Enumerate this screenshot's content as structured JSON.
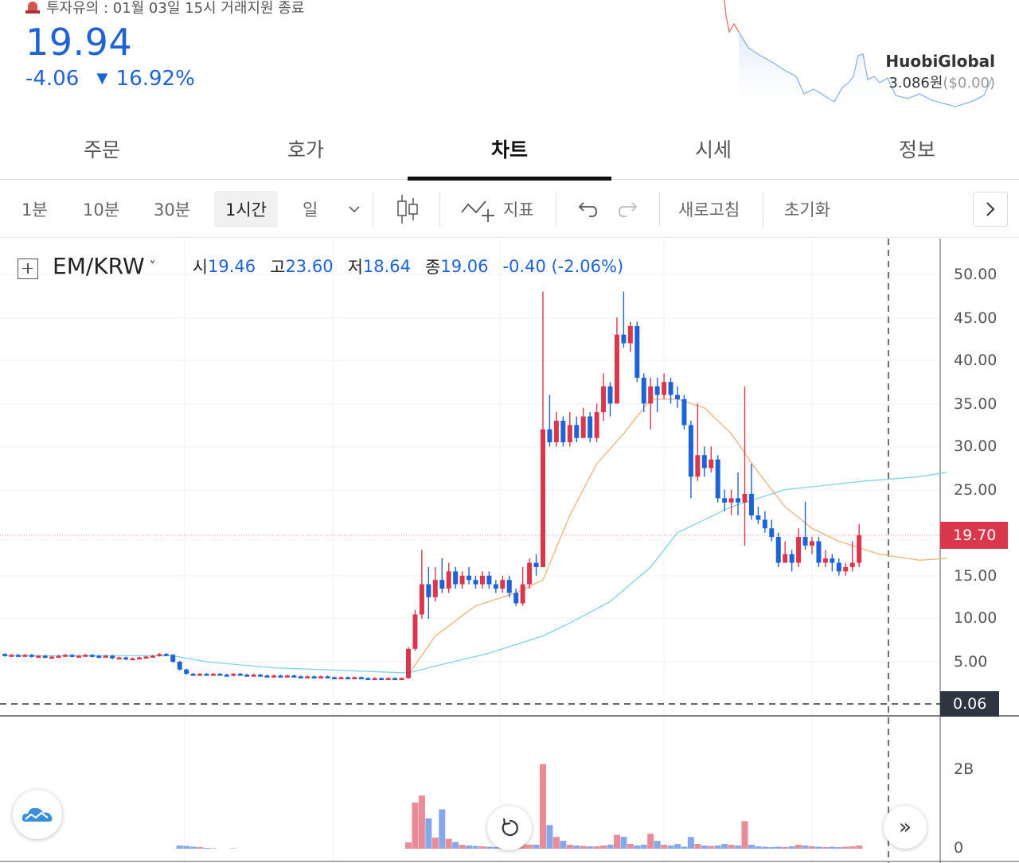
{
  "header": {
    "warning": "투자유의 : 01월 03일 15시 거래지원 종료",
    "price": "19.94",
    "change": "-4.06",
    "change_pct": "16.92%",
    "exchange_name": "HuobiGlobal",
    "exchange_price": "3.086원",
    "exchange_usd": "($0.00)"
  },
  "tabs": [
    "주문",
    "호가",
    "차트",
    "시세",
    "정보"
  ],
  "active_tab": "차트",
  "toolbar": {
    "intervals": [
      "1분",
      "10분",
      "30분",
      "1시간",
      "일"
    ],
    "selected_interval": "1시간",
    "indicator_label": "지표",
    "refresh_label": "새로고침",
    "reset_label": "초기화"
  },
  "legend": {
    "symbol": "EM/KRW",
    "open_label": "시",
    "open": "19.46",
    "high_label": "고",
    "high": "23.60",
    "low_label": "저",
    "low": "18.64",
    "close_label": "종",
    "close": "19.06",
    "change": "-0.40 (-2.06%)"
  },
  "colors": {
    "up": "#d9374b",
    "down": "#1e63d6",
    "ma_short": "#f3b27a",
    "ma_long": "#7fd3e6"
  },
  "chart_data": {
    "type": "candlestick",
    "price_axis_ticks": [
      "50.00",
      "45.00",
      "40.00",
      "35.00",
      "30.00",
      "25.00",
      "15.00",
      "10.00",
      "5.00"
    ],
    "current_price_label": "19.70",
    "low_price_label": "0.06",
    "volume_axis_ticks": [
      "2B",
      "0"
    ],
    "ylim": [
      0,
      52
    ],
    "candles": [
      [
        5.9,
        5.7,
        6.0,
        5.6
      ],
      [
        5.7,
        5.8,
        5.9,
        5.6
      ],
      [
        5.8,
        5.7,
        5.9,
        5.6
      ],
      [
        5.7,
        5.8,
        5.9,
        5.6
      ],
      [
        5.8,
        5.6,
        5.9,
        5.5
      ],
      [
        5.6,
        5.7,
        5.8,
        5.5
      ],
      [
        5.7,
        5.5,
        5.8,
        5.4
      ],
      [
        5.5,
        5.6,
        5.7,
        5.4
      ],
      [
        5.6,
        5.7,
        5.8,
        5.5
      ],
      [
        5.7,
        5.8,
        5.9,
        5.6
      ],
      [
        5.8,
        5.6,
        5.9,
        5.5
      ],
      [
        5.6,
        5.7,
        5.8,
        5.5
      ],
      [
        5.7,
        5.8,
        5.9,
        5.6
      ],
      [
        5.8,
        5.7,
        5.9,
        5.5
      ],
      [
        5.7,
        5.6,
        5.8,
        5.4
      ],
      [
        5.6,
        5.7,
        5.8,
        5.5
      ],
      [
        5.7,
        5.4,
        5.8,
        5.3
      ],
      [
        5.4,
        5.5,
        5.6,
        5.3
      ],
      [
        5.5,
        5.3,
        5.6,
        5.2
      ],
      [
        5.3,
        5.4,
        5.5,
        5.2
      ],
      [
        5.4,
        5.5,
        5.6,
        5.3
      ],
      [
        5.5,
        5.6,
        5.7,
        5.4
      ],
      [
        5.6,
        5.7,
        5.8,
        5.5
      ],
      [
        5.7,
        5.9,
        6.0,
        5.6
      ],
      [
        5.9,
        5.8,
        6.0,
        5.7
      ],
      [
        5.8,
        5.0,
        5.9,
        4.9
      ],
      [
        5.0,
        4.1,
        5.1,
        4.0
      ],
      [
        4.1,
        3.6,
        4.2,
        3.5
      ],
      [
        3.6,
        3.5,
        3.7,
        3.4
      ],
      [
        3.5,
        3.6,
        3.7,
        3.4
      ],
      [
        3.6,
        3.5,
        3.7,
        3.4
      ],
      [
        3.5,
        3.6,
        3.7,
        3.4
      ],
      [
        3.6,
        3.5,
        3.7,
        3.4
      ],
      [
        3.5,
        3.4,
        3.6,
        3.3
      ],
      [
        3.4,
        3.6,
        3.7,
        3.3
      ],
      [
        3.6,
        3.5,
        3.7,
        3.4
      ],
      [
        3.5,
        3.4,
        3.6,
        3.3
      ],
      [
        3.4,
        3.5,
        3.6,
        3.3
      ],
      [
        3.5,
        3.4,
        3.6,
        3.3
      ],
      [
        3.4,
        3.3,
        3.5,
        3.2
      ],
      [
        3.3,
        3.4,
        3.5,
        3.2
      ],
      [
        3.4,
        3.3,
        3.5,
        3.2
      ],
      [
        3.3,
        3.4,
        3.5,
        3.2
      ],
      [
        3.4,
        3.3,
        3.5,
        3.2
      ],
      [
        3.3,
        3.2,
        3.4,
        3.1
      ],
      [
        3.2,
        3.3,
        3.4,
        3.1
      ],
      [
        3.3,
        3.2,
        3.4,
        3.1
      ],
      [
        3.2,
        3.3,
        3.4,
        3.1
      ],
      [
        3.3,
        3.2,
        3.4,
        3.1
      ],
      [
        3.2,
        3.1,
        3.3,
        3.0
      ],
      [
        3.1,
        3.2,
        3.3,
        3.0
      ],
      [
        3.2,
        3.1,
        3.3,
        3.0
      ],
      [
        3.1,
        3.2,
        3.3,
        3.0
      ],
      [
        3.2,
        3.1,
        3.3,
        3.0
      ],
      [
        3.1,
        3.0,
        3.2,
        2.9
      ],
      [
        3.0,
        3.1,
        3.2,
        2.9
      ],
      [
        3.1,
        3.0,
        3.2,
        2.9
      ],
      [
        3.0,
        3.1,
        3.2,
        2.9
      ],
      [
        3.1,
        3.0,
        3.2,
        2.9
      ],
      [
        3.0,
        3.1,
        3.2,
        2.9
      ],
      [
        3.1,
        6.5,
        6.7,
        3.0
      ],
      [
        6.5,
        10.5,
        11.0,
        6.3
      ],
      [
        10.5,
        14.0,
        18.0,
        10.0
      ],
      [
        14.0,
        12.5,
        16.0,
        10.0
      ],
      [
        12.5,
        14.5,
        16.0,
        12.0
      ],
      [
        14.5,
        13.5,
        17.0,
        13.0
      ],
      [
        13.5,
        15.5,
        16.5,
        13.0
      ],
      [
        15.5,
        14.0,
        16.0,
        13.5
      ],
      [
        14.0,
        15.0,
        15.5,
        13.5
      ],
      [
        15.0,
        14.5,
        16.0,
        14.0
      ],
      [
        14.5,
        14.0,
        15.0,
        13.5
      ],
      [
        14.0,
        15.0,
        15.5,
        13.5
      ],
      [
        15.0,
        14.0,
        15.5,
        13.5
      ],
      [
        14.0,
        13.5,
        14.5,
        13.0
      ],
      [
        13.5,
        14.5,
        15.0,
        13.0
      ],
      [
        14.5,
        13.0,
        15.0,
        12.5
      ],
      [
        13.0,
        11.8,
        13.5,
        11.5
      ],
      [
        11.8,
        14.0,
        16.0,
        11.5
      ],
      [
        14.0,
        16.5,
        17.0,
        13.5
      ],
      [
        16.5,
        16.0,
        17.5,
        15.0
      ],
      [
        16.0,
        32.0,
        48.0,
        16.0
      ],
      [
        32.0,
        30.5,
        36.0,
        30.0
      ],
      [
        30.5,
        33.0,
        34.0,
        30.0
      ],
      [
        33.0,
        30.5,
        33.5,
        30.0
      ],
      [
        30.5,
        32.5,
        34.0,
        30.0
      ],
      [
        32.5,
        31.0,
        33.5,
        30.5
      ],
      [
        31.0,
        33.5,
        34.5,
        31.0
      ],
      [
        33.5,
        31.0,
        34.0,
        30.5
      ],
      [
        31.0,
        34.0,
        35.0,
        30.5
      ],
      [
        34.0,
        37.0,
        38.5,
        33.0
      ],
      [
        37.0,
        35.0,
        37.5,
        33.5
      ],
      [
        35.0,
        43.0,
        45.0,
        35.0
      ],
      [
        43.0,
        42.0,
        48.0,
        41.5
      ],
      [
        42.0,
        44.0,
        44.5,
        41.0
      ],
      [
        44.0,
        38.0,
        44.5,
        37.5
      ],
      [
        38.0,
        35.0,
        38.5,
        34.0
      ],
      [
        35.0,
        37.0,
        38.0,
        32.0
      ],
      [
        37.0,
        36.0,
        38.0,
        34.0
      ],
      [
        36.0,
        37.5,
        38.5,
        35.5
      ],
      [
        37.5,
        36.0,
        38.0,
        35.0
      ],
      [
        36.0,
        35.5,
        37.0,
        34.5
      ],
      [
        35.5,
        32.5,
        36.0,
        32.0
      ],
      [
        32.5,
        26.5,
        33.0,
        24.0
      ],
      [
        26.5,
        29.0,
        35.0,
        26.0
      ],
      [
        29.0,
        27.5,
        30.0,
        26.5
      ],
      [
        27.5,
        28.5,
        30.0,
        27.0
      ],
      [
        28.5,
        24.0,
        29.0,
        23.5
      ],
      [
        24.0,
        23.5,
        25.0,
        22.5
      ],
      [
        23.5,
        24.0,
        25.0,
        22.0
      ],
      [
        24.0,
        23.5,
        27.0,
        22.0
      ],
      [
        23.5,
        24.5,
        37.0,
        18.5
      ],
      [
        24.5,
        22.0,
        28.0,
        21.5
      ],
      [
        22.0,
        21.5,
        23.0,
        21.0
      ],
      [
        21.5,
        20.5,
        22.5,
        20.0
      ],
      [
        20.5,
        19.5,
        21.5,
        19.0
      ],
      [
        19.5,
        16.5,
        20.0,
        16.0
      ],
      [
        16.5,
        17.5,
        19.0,
        16.5
      ],
      [
        17.5,
        16.5,
        18.0,
        15.5
      ],
      [
        16.5,
        19.5,
        20.5,
        16.0
      ],
      [
        19.5,
        18.5,
        23.6,
        18.0
      ],
      [
        18.5,
        19.0,
        19.5,
        17.5
      ],
      [
        19.0,
        16.5,
        19.5,
        16.0
      ],
      [
        16.5,
        17.0,
        18.0,
        16.0
      ],
      [
        17.0,
        16.5,
        17.5,
        15.5
      ],
      [
        16.5,
        15.5,
        17.0,
        15.0
      ],
      [
        15.5,
        16.0,
        16.5,
        15.0
      ],
      [
        16.0,
        16.5,
        19.0,
        15.5
      ],
      [
        16.5,
        19.7,
        21.0,
        16.0
      ]
    ],
    "volumes_billion": [
      0,
      0,
      0,
      0,
      0,
      0,
      0,
      0,
      0,
      0,
      0,
      0,
      0,
      0,
      0,
      0,
      0,
      0,
      0,
      0,
      0,
      0,
      0,
      0,
      0,
      0,
      0.08,
      0.07,
      0.05,
      0.04,
      0.02,
      0.01,
      0,
      0,
      0.01,
      0,
      0,
      0,
      0,
      0,
      0,
      0,
      0,
      0,
      0,
      0,
      0,
      0,
      0,
      0,
      0,
      0,
      0,
      0,
      0,
      0,
      0,
      0,
      0,
      0,
      0.16,
      1.17,
      1.35,
      0.77,
      0.28,
      1.0,
      0.25,
      0.17,
      0.1,
      0.08,
      0.07,
      0.06,
      0.05,
      0.04,
      0.12,
      0.22,
      0.12,
      0.3,
      0.1,
      0.1,
      2.15,
      0.6,
      0.3,
      0.2,
      0.1,
      0.08,
      0.07,
      0.06,
      0.06,
      0.08,
      0.1,
      0.35,
      0.3,
      0.12,
      0.08,
      0.1,
      0.38,
      0.2,
      0.1,
      0.08,
      0.12,
      0.05,
      0.3,
      0.12,
      0.08,
      0.07,
      0.08,
      0.12,
      0.1,
      0.08,
      0.7,
      0.1,
      0.06,
      0.05,
      0.04,
      0.05,
      0.04,
      0.06,
      0.1,
      0.08,
      0.06,
      0.05,
      0.04,
      0.05,
      0.04,
      0.05,
      0.06,
      0.08
    ],
    "ma_short": [
      [
        60,
        3.5
      ],
      [
        64,
        8.0
      ],
      [
        70,
        11.5
      ],
      [
        76,
        13.0
      ],
      [
        80,
        14.5
      ],
      [
        84,
        22.0
      ],
      [
        88,
        28.0
      ],
      [
        92,
        31.5
      ],
      [
        96,
        35.5
      ],
      [
        100,
        35.5
      ],
      [
        104,
        34.5
      ],
      [
        108,
        31.5
      ],
      [
        112,
        27.0
      ],
      [
        116,
        23.0
      ],
      [
        120,
        20.5
      ],
      [
        124,
        19.0
      ],
      [
        130,
        17.5
      ],
      [
        136,
        16.8
      ],
      [
        140,
        17.0
      ]
    ],
    "ma_long": [
      [
        0,
        5.7
      ],
      [
        25,
        5.7
      ],
      [
        30,
        5.0
      ],
      [
        40,
        4.3
      ],
      [
        50,
        4.0
      ],
      [
        60,
        3.7
      ],
      [
        64,
        4.5
      ],
      [
        72,
        6.0
      ],
      [
        80,
        8.0
      ],
      [
        84,
        9.5
      ],
      [
        90,
        12.0
      ],
      [
        96,
        16.0
      ],
      [
        100,
        20.0
      ],
      [
        108,
        23.0
      ],
      [
        116,
        25.0
      ],
      [
        122,
        25.5
      ],
      [
        128,
        26.0
      ],
      [
        136,
        26.5
      ],
      [
        140,
        27.0
      ]
    ]
  }
}
